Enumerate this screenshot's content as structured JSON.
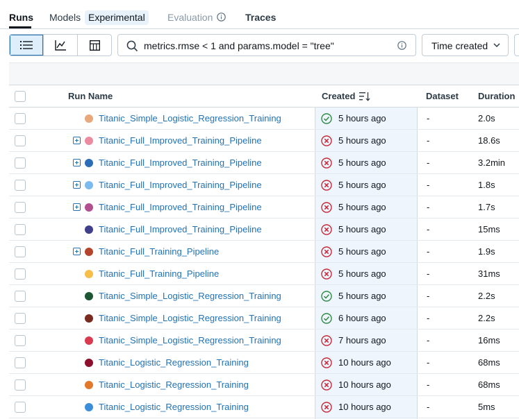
{
  "tabs": {
    "runs": "Runs",
    "models": "Models",
    "experimental": "Experimental",
    "evaluation": "Evaluation",
    "traces": "Traces"
  },
  "toolbar": {
    "search_value": "metrics.rmse < 1 and params.model = \"tree\"",
    "sort_label": "Time created"
  },
  "table": {
    "headers": {
      "run_name": "Run Name",
      "created": "Created",
      "dataset": "Dataset",
      "duration": "Duration"
    },
    "rows": [
      {
        "name": "Titanic_Simple_Logistic_Regression_Training",
        "color": "#e8a87c",
        "expandable": false,
        "status": "success",
        "created": "5 hours ago",
        "dataset": "-",
        "duration": "2.0s"
      },
      {
        "name": "Titanic_Full_Improved_Training_Pipeline",
        "color": "#ec8aa0",
        "expandable": true,
        "status": "failed",
        "created": "5 hours ago",
        "dataset": "-",
        "duration": "18.6s"
      },
      {
        "name": "Titanic_Full_Improved_Training_Pipeline",
        "color": "#2c6db5",
        "expandable": true,
        "status": "failed",
        "created": "5 hours ago",
        "dataset": "-",
        "duration": "3.2min"
      },
      {
        "name": "Titanic_Full_Improved_Training_Pipeline",
        "color": "#7cbbef",
        "expandable": true,
        "status": "failed",
        "created": "5 hours ago",
        "dataset": "-",
        "duration": "1.8s"
      },
      {
        "name": "Titanic_Full_Improved_Training_Pipeline",
        "color": "#b24f91",
        "expandable": true,
        "status": "failed",
        "created": "5 hours ago",
        "dataset": "-",
        "duration": "1.7s"
      },
      {
        "name": "Titanic_Full_Improved_Training_Pipeline",
        "color": "#403f8c",
        "expandable": false,
        "status": "failed",
        "created": "5 hours ago",
        "dataset": "-",
        "duration": "15ms"
      },
      {
        "name": "Titanic_Full_Training_Pipeline",
        "color": "#b4452c",
        "expandable": true,
        "status": "failed",
        "created": "5 hours ago",
        "dataset": "-",
        "duration": "1.9s"
      },
      {
        "name": "Titanic_Full_Training_Pipeline",
        "color": "#f7be4a",
        "expandable": false,
        "status": "failed",
        "created": "5 hours ago",
        "dataset": "-",
        "duration": "31ms"
      },
      {
        "name": "Titanic_Simple_Logistic_Regression_Training",
        "color": "#1c5633",
        "expandable": false,
        "status": "success",
        "created": "5 hours ago",
        "dataset": "-",
        "duration": "2.2s"
      },
      {
        "name": "Titanic_Simple_Logistic_Regression_Training",
        "color": "#7a2b1f",
        "expandable": false,
        "status": "success",
        "created": "6 hours ago",
        "dataset": "-",
        "duration": "2.2s"
      },
      {
        "name": "Titanic_Simple_Logistic_Regression_Training",
        "color": "#d93a4f",
        "expandable": false,
        "status": "failed",
        "created": "7 hours ago",
        "dataset": "-",
        "duration": "16ms"
      },
      {
        "name": "Titanic_Logistic_Regression_Training",
        "color": "#8c0f2c",
        "expandable": false,
        "status": "failed",
        "created": "10 hours ago",
        "dataset": "-",
        "duration": "68ms"
      },
      {
        "name": "Titanic_Logistic_Regression_Training",
        "color": "#e2782c",
        "expandable": false,
        "status": "failed",
        "created": "10 hours ago",
        "dataset": "-",
        "duration": "68ms"
      },
      {
        "name": "Titanic_Logistic_Regression_Training",
        "color": "#3b8fd9",
        "expandable": false,
        "status": "failed",
        "created": "10 hours ago",
        "dataset": "-",
        "duration": "5ms"
      }
    ]
  },
  "colors": {
    "link": "#2272b4",
    "success": "#2e8a43",
    "failed": "#c8283b"
  }
}
